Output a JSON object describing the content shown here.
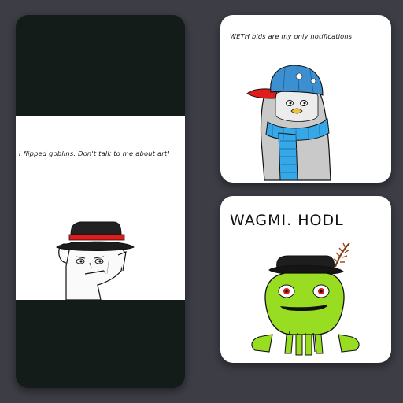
{
  "cards": {
    "left": {
      "caption": "I flipped goblins. Don't talk to me about art!"
    },
    "top_right": {
      "caption": "WETH bids are my only notifications"
    },
    "bottom_right": {
      "caption": "WAGMI. HODL"
    }
  },
  "colors": {
    "background": "#3c3d45",
    "card_dark": "#131c18",
    "goblin_green": "#99dd22",
    "cap_blue": "#3c8fd0",
    "scarf_blue": "#36a8e8",
    "hat_band_red": "#e21b1b"
  },
  "icons": [
    "goblin-with-hat",
    "penguin-with-cap-and-scarf",
    "green-goblin-with-feather-hat"
  ]
}
